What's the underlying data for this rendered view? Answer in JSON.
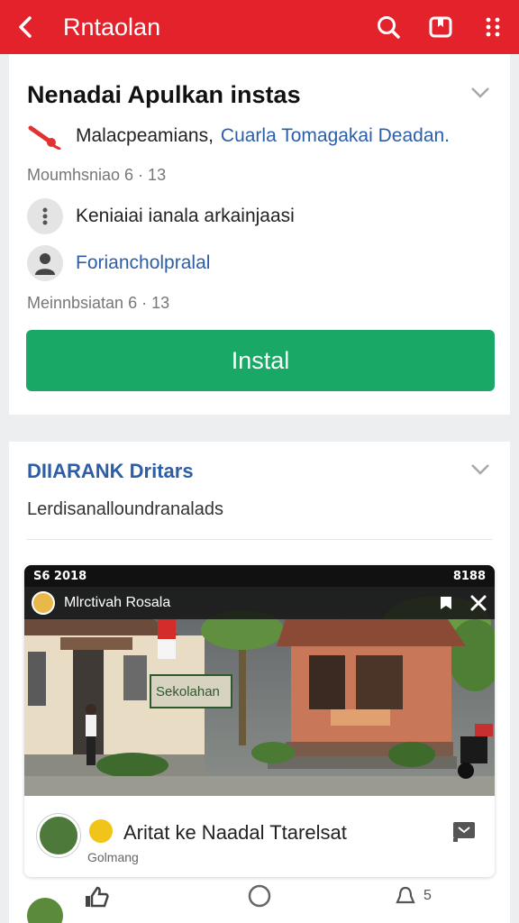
{
  "header": {
    "title": "Rntaolan",
    "icons": [
      "back-arrow-icon",
      "search-icon",
      "bookmark-icon",
      "more-icon"
    ],
    "bar_color": "#e3222b"
  },
  "install_card": {
    "title": "Nenadai Apulkan instas",
    "publisher_prefix": "Malacpeamians,",
    "publisher_link": "Cuarla Tomagakai Deadan.",
    "meta_1": "Moumhsniao 6 · 13",
    "option_1": "Keniaiai ianala arkainjaasi",
    "option_2": "Foriancholpralal",
    "meta_2": "Meinnbsiatan 6 · 13",
    "install_label": "Instal",
    "install_color": "#19a865"
  },
  "section": {
    "title": "DIIARANK Dritars",
    "subtitle": "Lerdisanalloundranalads"
  },
  "video": {
    "status_left": "S6 2018",
    "status_right": "8188",
    "overlay_name": "Mlrctivah Rosala",
    "sign_text": "Sekolahan",
    "channel_name": "Aritat ke Naadal Ttarelsat",
    "channel_sub": "Golmang"
  },
  "bottom": {
    "comment_count": "5"
  }
}
